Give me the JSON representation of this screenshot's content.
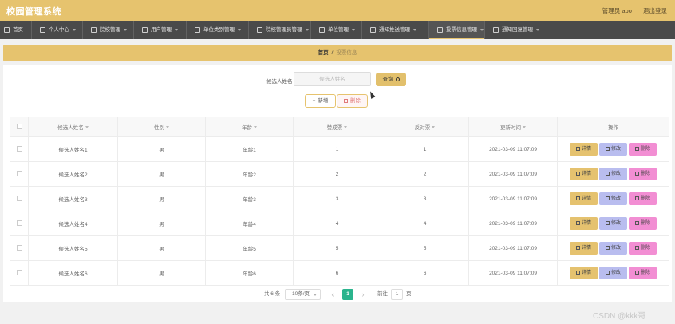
{
  "app": {
    "title": "校园管理系统"
  },
  "topbar": {
    "user_label": "管理员 abo",
    "logout_label": "退出登录"
  },
  "nav": [
    {
      "label": "首页",
      "icon": "home-icon",
      "has_caret": false
    },
    {
      "label": "个人中心",
      "icon": "user-icon",
      "has_caret": true
    },
    {
      "label": "院校管理",
      "icon": "school-icon",
      "has_caret": true
    },
    {
      "label": "用户管理",
      "icon": "users-icon",
      "has_caret": true
    },
    {
      "label": "单位类别管理",
      "icon": "list-icon",
      "has_caret": true
    },
    {
      "label": "院校管理员管理",
      "icon": "list-icon",
      "has_caret": true
    },
    {
      "label": "单位管理",
      "icon": "building-icon",
      "has_caret": true
    },
    {
      "label": "通知推送管理",
      "icon": "bell-icon",
      "has_caret": true
    },
    {
      "label": "投票信息管理",
      "icon": "vote-icon",
      "has_caret": true,
      "active": true
    },
    {
      "label": "通知回复管理",
      "icon": "reply-icon",
      "has_caret": true
    }
  ],
  "breadcrumb": {
    "home": "首页",
    "separator": "/",
    "current": "投票信息"
  },
  "search": {
    "label": "候选人姓名",
    "placeholder": "候选人姓名",
    "value": "",
    "button_label": "查询"
  },
  "actions": {
    "add_label": "新增",
    "delete_label": "删除"
  },
  "table": {
    "columns": [
      "候选人姓名",
      "性别",
      "年龄",
      "赞成票",
      "反对票",
      "更新时间",
      "操作"
    ],
    "rows": [
      {
        "name": "候选人姓名1",
        "gender": "男",
        "age": "年龄1",
        "approve": "1",
        "oppose": "1",
        "updated": "2021-03-09 11:07:09"
      },
      {
        "name": "候选人姓名2",
        "gender": "男",
        "age": "年龄2",
        "approve": "2",
        "oppose": "2",
        "updated": "2021-03-09 11:07:09"
      },
      {
        "name": "候选人姓名3",
        "gender": "男",
        "age": "年龄3",
        "approve": "3",
        "oppose": "3",
        "updated": "2021-03-09 11:07:09"
      },
      {
        "name": "候选人姓名4",
        "gender": "男",
        "age": "年龄4",
        "approve": "4",
        "oppose": "4",
        "updated": "2021-03-09 11:07:09"
      },
      {
        "name": "候选人姓名5",
        "gender": "男",
        "age": "年龄5",
        "approve": "5",
        "oppose": "5",
        "updated": "2021-03-09 11:07:09"
      },
      {
        "name": "候选人姓名6",
        "gender": "男",
        "age": "年龄6",
        "approve": "6",
        "oppose": "6",
        "updated": "2021-03-09 11:07:09"
      }
    ],
    "row_actions": {
      "detail": "详情",
      "edit": "修改",
      "delete": "删除"
    }
  },
  "pagination": {
    "total": "共 6 条",
    "page_size": "10条/页",
    "current_page": "1",
    "goto_label": "前往",
    "goto_value": "1",
    "goto_unit": "页"
  },
  "watermark": "CSDN @kkk哥",
  "colors": {
    "accent": "#e6c36e",
    "nav_bg": "#4a4a4a",
    "page_active": "#2ab48d",
    "edit": "#b9bdef",
    "delete": "#f28ed3"
  }
}
